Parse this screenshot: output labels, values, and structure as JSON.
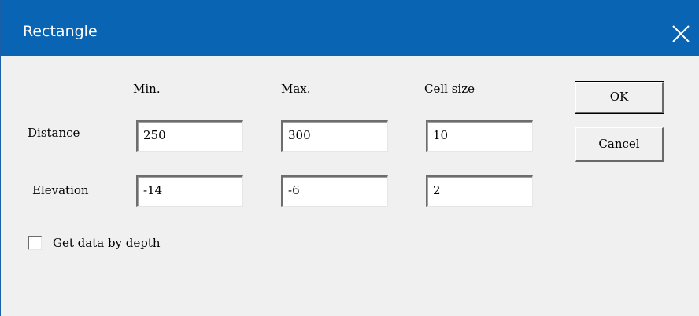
{
  "window": {
    "title": "Rectangle",
    "titlebar_color": "#0a64b4",
    "close_icon": "close-icon"
  },
  "columns": {
    "min_label": "Min.",
    "max_label": "Max.",
    "cell_size_label": "Cell size"
  },
  "rows": {
    "distance": {
      "label": "Distance",
      "min": "250",
      "max": "300",
      "cell_size": "10"
    },
    "elevation": {
      "label": "Elevation",
      "min": "-14",
      "max": "-6",
      "cell_size": "2"
    }
  },
  "options": {
    "get_data_by_depth_label": "Get data by depth",
    "get_data_by_depth_checked": false
  },
  "buttons": {
    "ok_label": "OK",
    "cancel_label": "Cancel"
  }
}
